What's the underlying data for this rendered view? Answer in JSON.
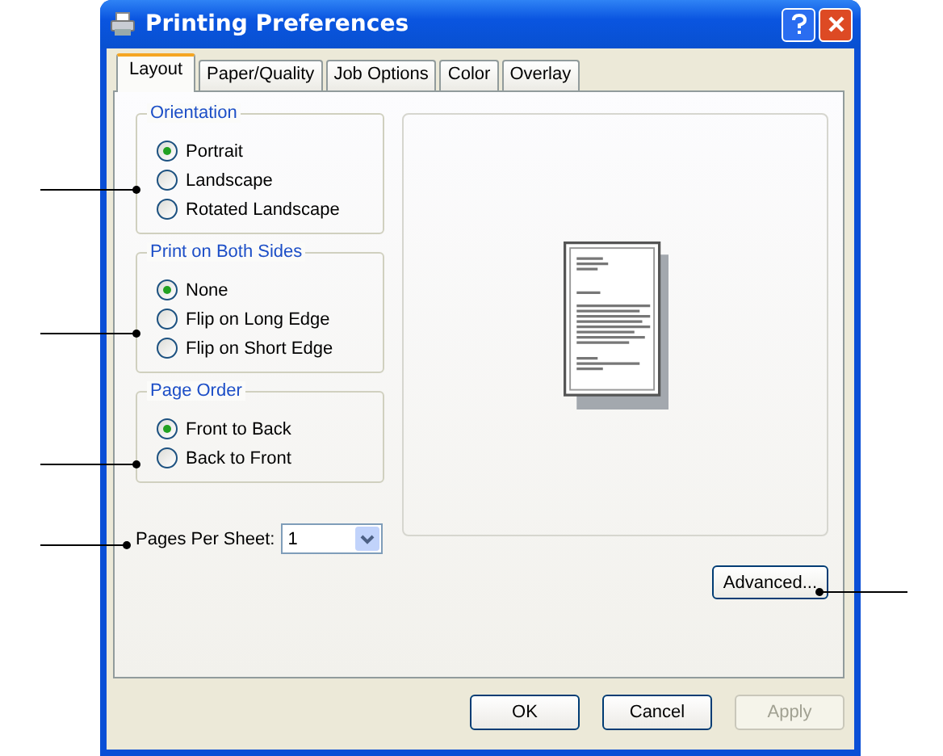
{
  "window": {
    "title": "Printing Preferences"
  },
  "tabs": [
    {
      "label": "Layout",
      "selected": true
    },
    {
      "label": "Paper/Quality",
      "selected": false
    },
    {
      "label": "Job Options",
      "selected": false
    },
    {
      "label": "Color",
      "selected": false
    },
    {
      "label": "Overlay",
      "selected": false
    }
  ],
  "groups": [
    {
      "title": "Orientation",
      "options": [
        {
          "label": "Portrait",
          "selected": true
        },
        {
          "label": "Landscape",
          "selected": false
        },
        {
          "label": "Rotated Landscape",
          "selected": false
        }
      ]
    },
    {
      "title": "Print on Both Sides",
      "options": [
        {
          "label": "None",
          "selected": true
        },
        {
          "label": "Flip on Long Edge",
          "selected": false
        },
        {
          "label": "Flip on Short Edge",
          "selected": false
        }
      ]
    },
    {
      "title": "Page Order",
      "options": [
        {
          "label": "Front to Back",
          "selected": true
        },
        {
          "label": "Back to Front",
          "selected": false
        }
      ]
    }
  ],
  "pages_per_sheet": {
    "label": "Pages Per Sheet:",
    "value": "1"
  },
  "advanced_button": "Advanced...",
  "buttons": [
    {
      "label": "OK",
      "disabled": false
    },
    {
      "label": "Cancel",
      "disabled": false
    },
    {
      "label": "Apply",
      "disabled": true
    }
  ]
}
